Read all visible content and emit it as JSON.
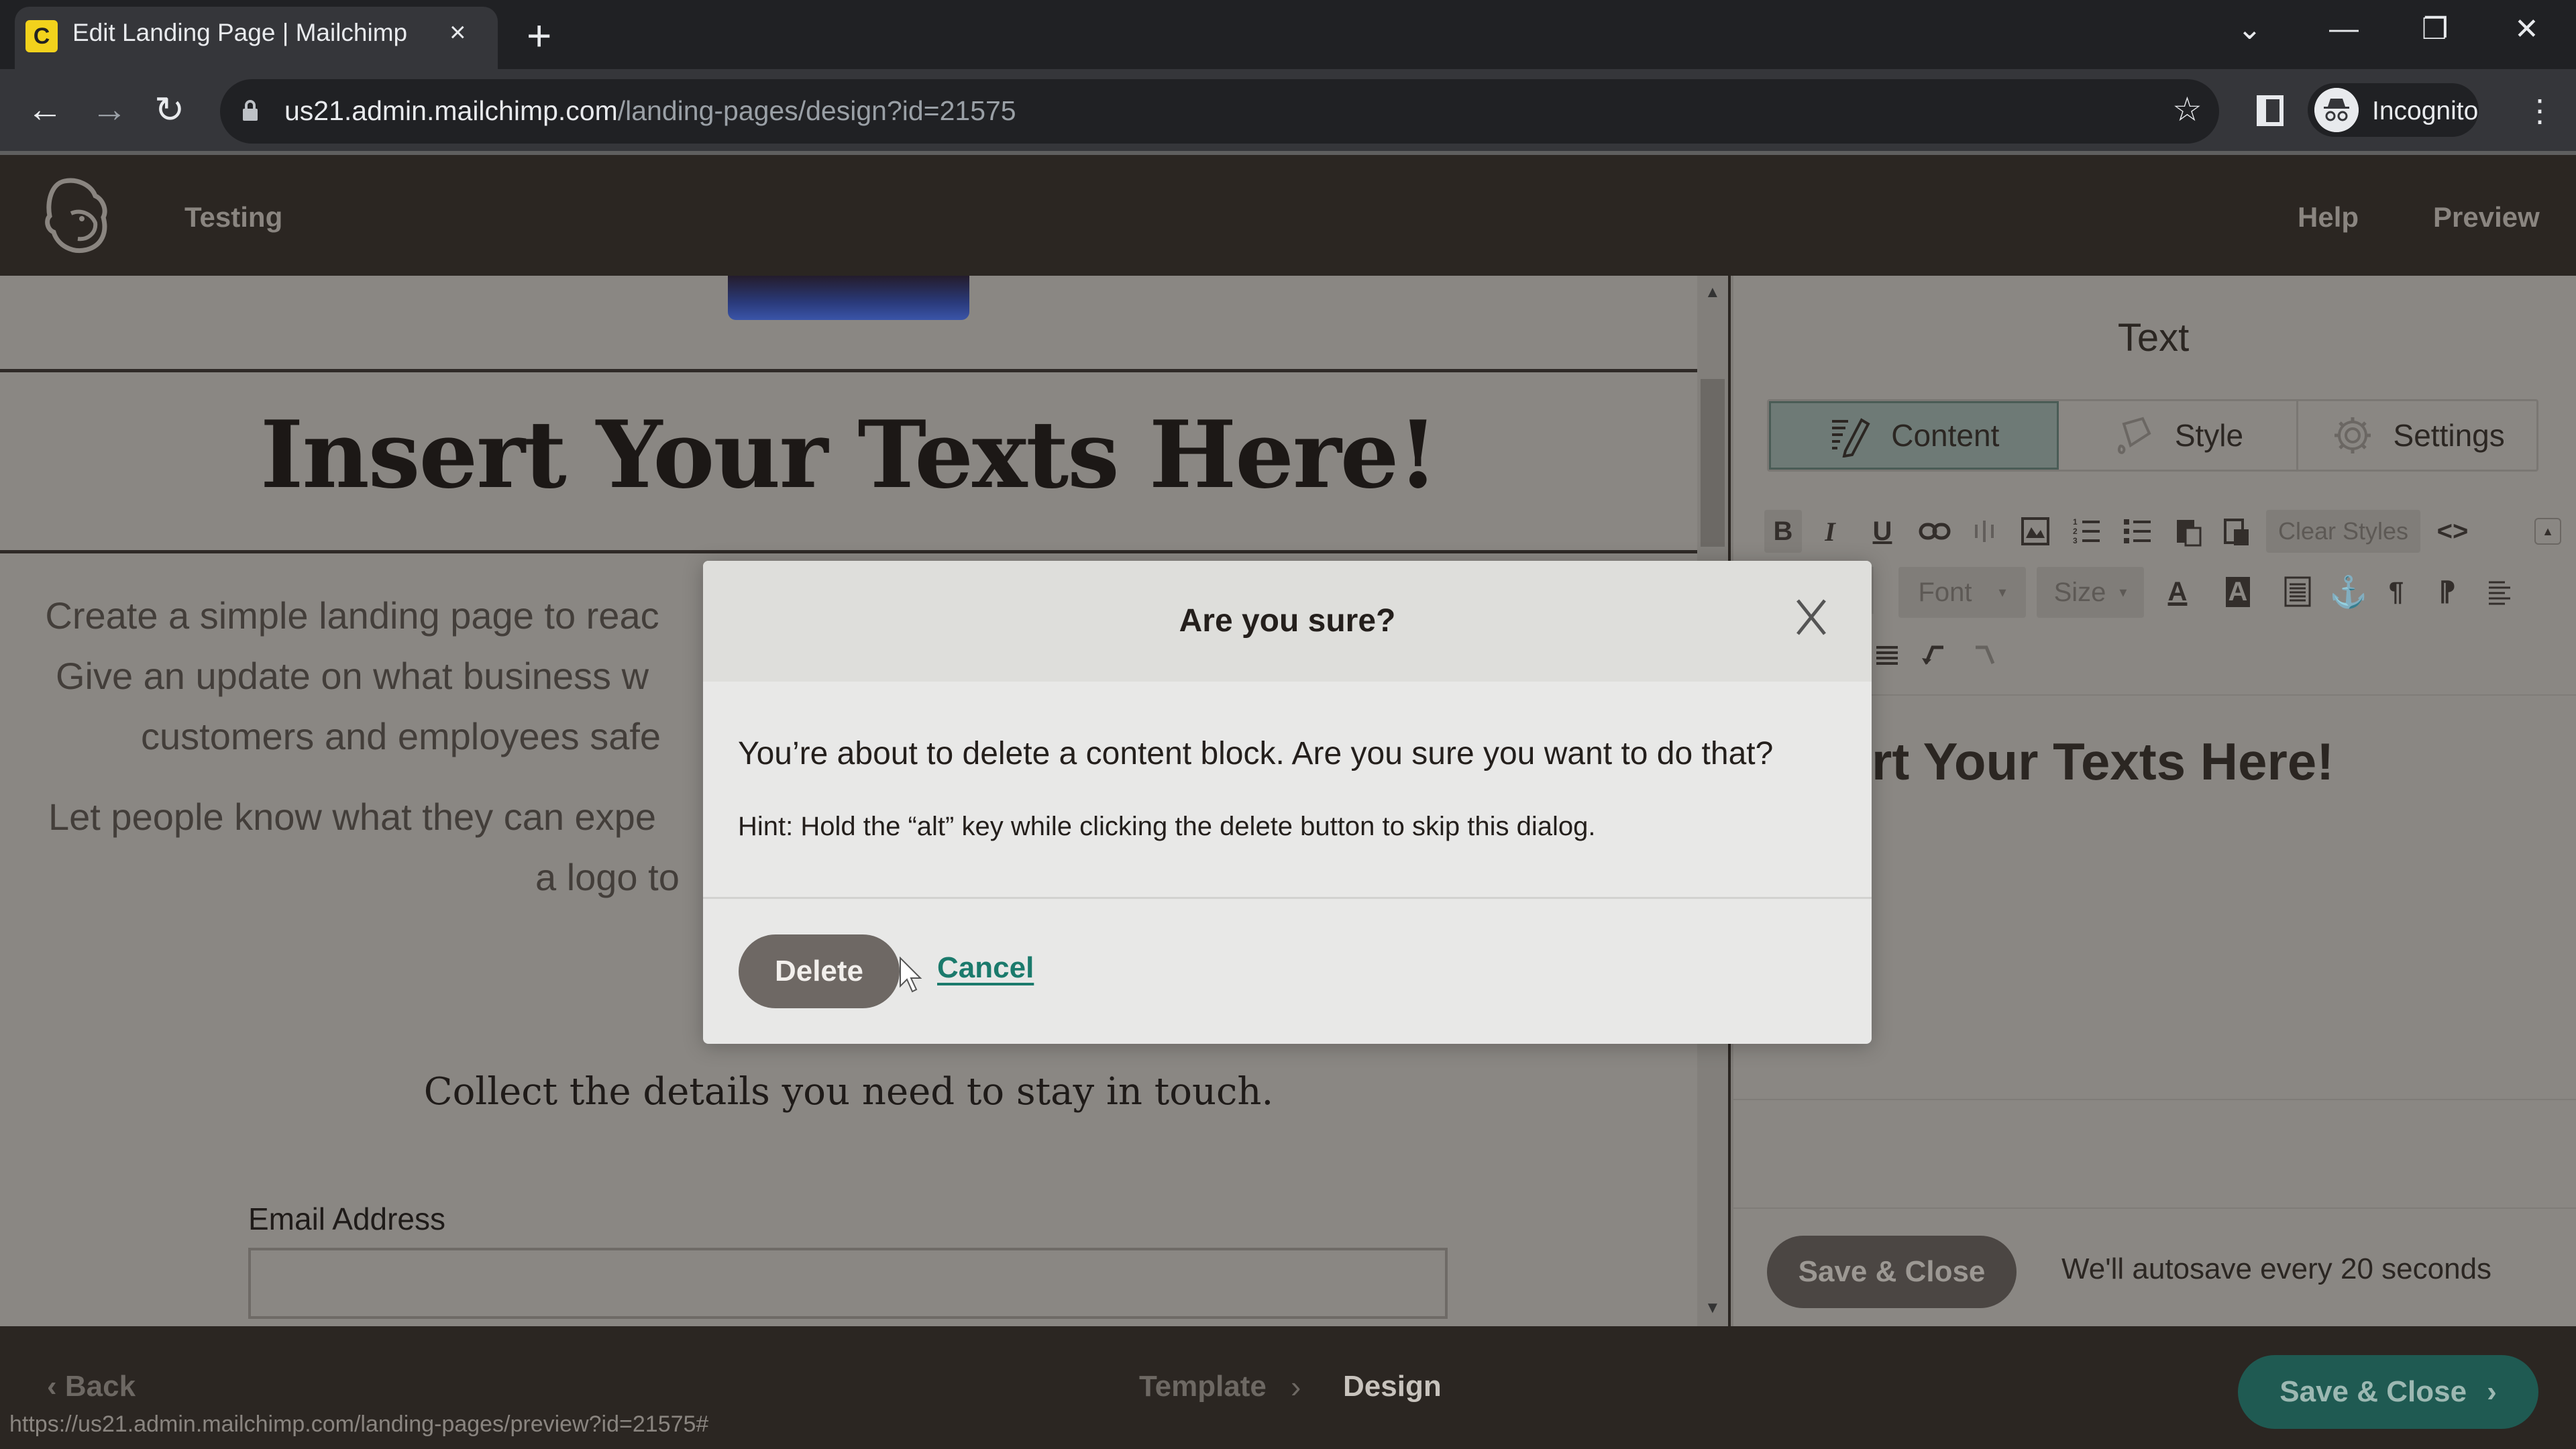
{
  "browser": {
    "tab_title": "Edit Landing Page | Mailchimp",
    "favicon_glyph": "C",
    "new_tab_glyph": "+",
    "tab_close_glyph": "×",
    "url_host": "us21.admin.mailchimp.com",
    "url_path": "/landing-pages/design?id=21575",
    "profile_label": "Incognito",
    "status_url": "https://us21.admin.mailchimp.com/landing-pages/preview?id=21575#",
    "window_controls": {
      "tab_search": "⌄",
      "minimize": "—",
      "restore": "❐",
      "close": "✕"
    },
    "nav": {
      "back": "←",
      "forward": "→",
      "reload": "↻",
      "star": "☆",
      "menu": "⋮"
    }
  },
  "header": {
    "title": "Testing",
    "help_label": "Help",
    "preview_label": "Preview"
  },
  "canvas": {
    "headline": "Insert Your Texts Here!",
    "body_lines": [
      "Create a simple landing page to reac",
      "Give an update on what business w",
      "customers and employees safe",
      "Let people know what they can expe",
      "a logo to"
    ],
    "collect_text": "Collect the details you need to stay in touch.",
    "email_label": "Email Address",
    "email_value": "",
    "scroll_up": "▲",
    "scroll_down": "▼"
  },
  "panel": {
    "title": "Text",
    "tabs": [
      {
        "label": "Content",
        "active": true
      },
      {
        "label": "Style",
        "active": false
      },
      {
        "label": "Settings",
        "active": false
      }
    ],
    "toolbar": {
      "bold": "B",
      "italic": "I",
      "underline": "U",
      "clear_styles": "Clear Styles",
      "source": "<>",
      "font_label": "Font",
      "size_label": "Size",
      "caret": "▾",
      "collapse": "▲"
    },
    "preview_text": "rt Your Texts Here!",
    "save_label": "Save & Close",
    "autosave_text": "We'll autosave every 20 seconds"
  },
  "footer": {
    "back_label": "Back",
    "breadcrumb": [
      "Template",
      "Design"
    ],
    "breadcrumb_sep": "›",
    "save_label": "Save & Close",
    "save_chevron": "›"
  },
  "modal": {
    "title": "Are you sure?",
    "message": "You’re about to delete a content block. Are you sure you want to do that?",
    "hint": "Hint: Hold the “alt” key while clicking the delete button to skip this dialog.",
    "delete_label": "Delete",
    "cancel_label": "Cancel"
  },
  "colors": {
    "accent_teal": "#1f5a52",
    "link_teal": "#1b7a6c",
    "header_bg": "#2b2622",
    "overlay_gray": "#8a8783",
    "favicon_yellow": "#f2d21c"
  }
}
